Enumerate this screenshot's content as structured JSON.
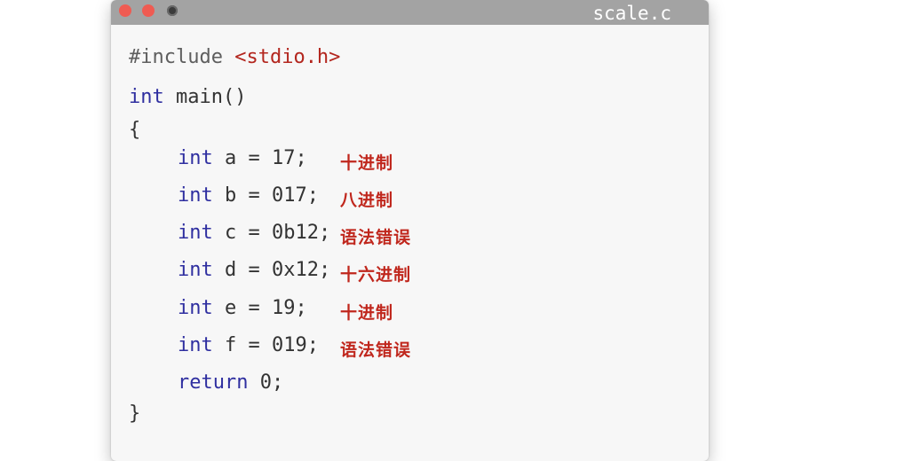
{
  "window": {
    "title": "scale.c"
  },
  "code": {
    "include_directive": "#include",
    "include_header": "<stdio.h>",
    "main_type": "int",
    "main_sig": " main()",
    "open_brace": "{",
    "lines": [
      {
        "type": "int",
        "rest": " a = 17;",
        "note": "十进制"
      },
      {
        "type": "int",
        "rest": " b = 017;",
        "note": "八进制"
      },
      {
        "type": "int",
        "rest": " c = 0b12;",
        "note": "语法错误"
      },
      {
        "type": "int",
        "rest": " d = 0x12;",
        "note": "十六进制"
      },
      {
        "type": "int",
        "rest": " e = 19;",
        "note": "十进制"
      },
      {
        "type": "int",
        "rest": " f = 019;",
        "note": "语法错误"
      }
    ],
    "return_kw": "return",
    "return_rest": " 0;",
    "close_brace": "}"
  }
}
